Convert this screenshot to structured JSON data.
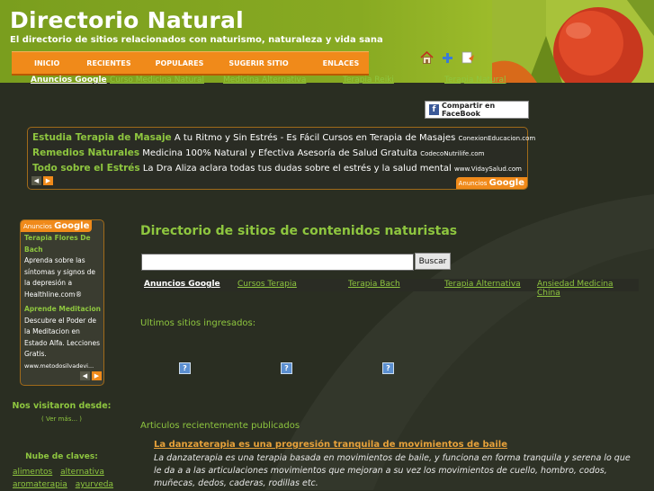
{
  "header": {
    "title": "Directorio Natural",
    "subtitle": "El directorio de sitios relacionados con naturismo, naturaleza y vida sana"
  },
  "nav": {
    "items": [
      "INICIO",
      "RECIENTES",
      "POPULARES",
      "SUGERIR SITIO",
      "ENLACES"
    ]
  },
  "top_icons": [
    "home-icon",
    "plus-icon",
    "bookmark-icon"
  ],
  "ad_links_top": {
    "label": "Anuncios Google",
    "links": [
      "Curso Medicina Natural",
      "Medicina Alternativa",
      "Terapia Reiki",
      "Terapia Natural"
    ]
  },
  "facebook": {
    "label": "Compartir en FaceBook"
  },
  "ad_box": {
    "ads": [
      {
        "title": "Estudia Terapia de Masaje",
        "text": "A tu Ritmo y Sin Estrés - Es Fácil Cursos en Terapia de Masajes",
        "url": "ConexionEducacion.com"
      },
      {
        "title": "Remedios Naturales",
        "text": "Medicina 100% Natural y Efectiva Asesoría de Salud Gratuita",
        "url": "CodecoNutrilife.com"
      },
      {
        "title": "Todo sobre el Estrés",
        "text": "La Dra Aliza aclara todas tus dudas sobre el estrés y la salud mental",
        "url": "www.VidaySalud.com"
      }
    ],
    "badge_small": "Anuncios",
    "badge_big": "Google"
  },
  "sidebar": {
    "ads_badge_small": "Anuncios",
    "ads_badge_big": "Google",
    "ads": [
      {
        "title": "Terapia Flores De Bach",
        "text": "Aprenda sobre las síntomas y signos de la depresión a Healthline.com®",
        "url": ""
      },
      {
        "title": "Aprende Meditacion",
        "text": "Descubre el Poder de la Meditacion en Estado Alfa. Lecciones Gratis.",
        "url": "www.metodosilvadevi..."
      }
    ],
    "visitors_title": "Nos visitaron desde:",
    "see_more": "( Ver más... )",
    "cloud_title": "Nube de claves:",
    "tags": [
      "alimentos",
      "alternativa",
      "aromaterapia",
      "ayurveda"
    ]
  },
  "main": {
    "title": "Directorio de sitios de contenidos naturistas",
    "search_value": "",
    "search_button": "Buscar",
    "ad_links": {
      "label": "Anuncios Google",
      "links": [
        "Cursos Terapia",
        "Terapia Bach",
        "Terapia Alternativa",
        "Ansiedad Medicina China"
      ]
    },
    "latest_title": "Ultimos sitios ingresados:",
    "articles_title": "Articulos recientemente publicados",
    "article": {
      "title": "La danzaterapia es una progresión tranquila de movimientos de baile",
      "description": "La danzaterapia es una terapia basada en movimientos de baile, y funciona en forma tranquila y serena lo que le da a a las articulaciones movimientos que mejoran a su vez los movimientos de cuello, hombro, codos, muñecas, dedos, caderas, rodillas etc."
    }
  },
  "colors": {
    "accent_green": "#8ec63f",
    "nav_orange": "#f08a1a",
    "background": "#2a2e22",
    "article_link": "#e8a23a"
  }
}
